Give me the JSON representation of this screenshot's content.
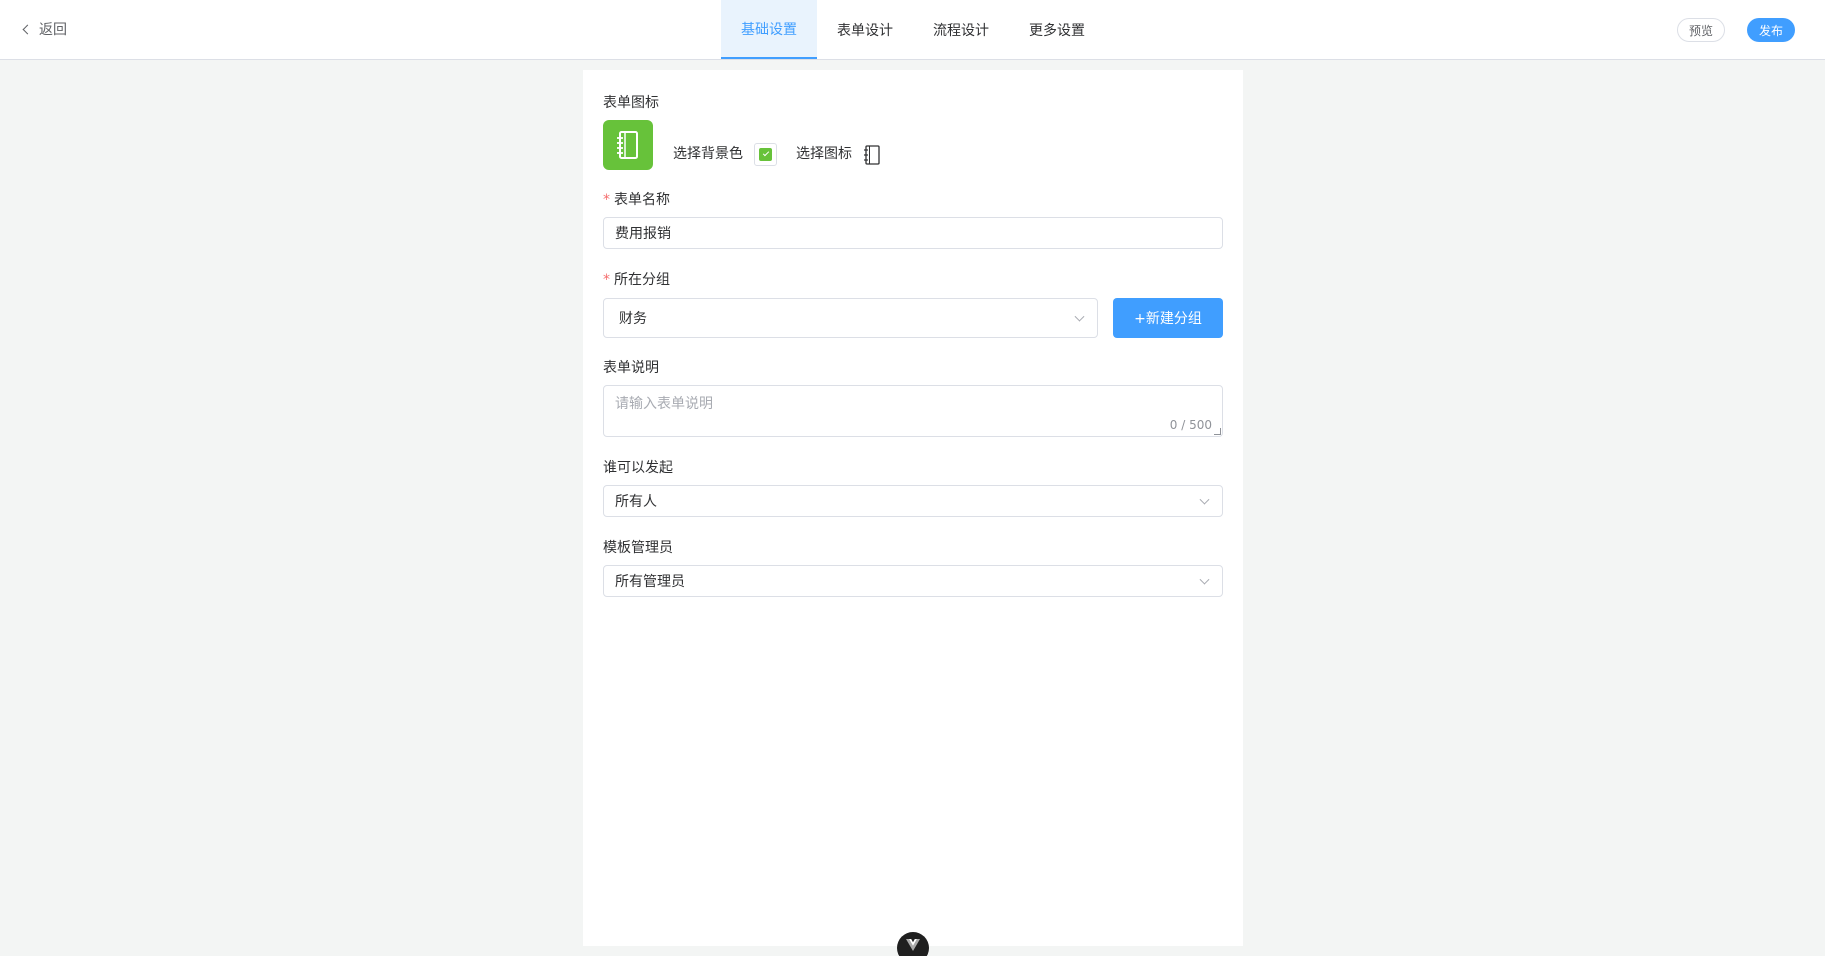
{
  "header": {
    "back_label": "返回",
    "tabs": [
      {
        "label": "基础设置",
        "active": true
      },
      {
        "label": "表单设计",
        "active": false
      },
      {
        "label": "流程设计",
        "active": false
      },
      {
        "label": "更多设置",
        "active": false
      }
    ],
    "preview_label": "预览",
    "publish_label": "发布"
  },
  "form": {
    "icon_section_label": "表单图标",
    "icon_color": "#67c23a",
    "icon_name": "notebook-icon",
    "choose_bg_label": "选择背景色",
    "choose_icon_label": "选择图标",
    "name_label": "表单名称",
    "name_value": "费用报销",
    "group_label": "所在分组",
    "group_value": "财务",
    "new_group_label": "+新建分组",
    "desc_label": "表单说明",
    "desc_placeholder": "请输入表单说明",
    "desc_counter": "0 / 500",
    "initiator_label": "谁可以发起",
    "initiator_value": "所有人",
    "admin_label": "模板管理员",
    "admin_value": "所有管理员"
  },
  "colors": {
    "accent": "#409eff",
    "tab_active_bg": "#e9f3fd",
    "required": "#f56c6c"
  }
}
